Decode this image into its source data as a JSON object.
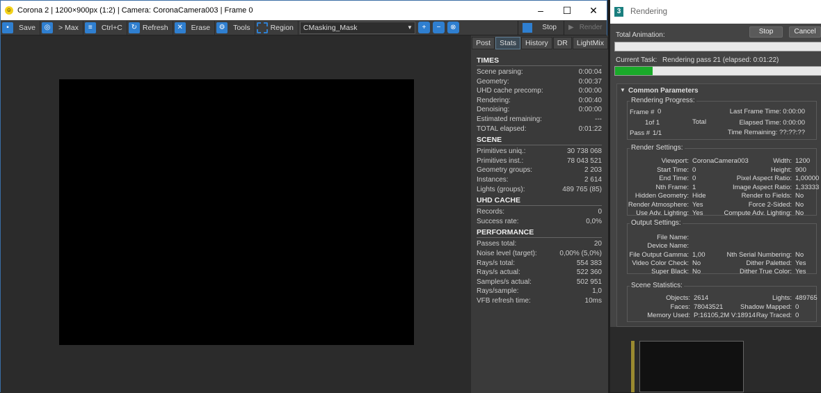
{
  "vfb": {
    "title": "Corona 2 | 1200×900px (1:2) | Camera: CoronaCamera003 | Frame 0",
    "window_controls": [
      "–",
      "☐",
      "✕"
    ],
    "toolbar": {
      "save": "Save",
      "max": "> Max",
      "copy": "Ctrl+C",
      "refresh": "Refresh",
      "erase": "Erase",
      "tools": "Tools",
      "region": "Region",
      "channel": "CMasking_Mask",
      "stop": "Stop",
      "render": "Render"
    },
    "tabs": [
      "Post",
      "Stats",
      "History",
      "DR",
      "LightMix"
    ],
    "stats": [
      {
        "header": "TIMES",
        "rows": [
          [
            "Scene parsing:",
            "0:00:04"
          ],
          [
            "Geometry:",
            "0:00:37"
          ],
          [
            "UHD cache precomp:",
            "0:00:00"
          ],
          [
            "Rendering:",
            "0:00:40"
          ],
          [
            "Denoising:",
            "0:00:00"
          ],
          [
            "Estimated remaining:",
            "---"
          ],
          [
            "TOTAL elapsed:",
            "0:01:22"
          ]
        ]
      },
      {
        "header": "SCENE",
        "rows": [
          [
            "Primitives uniq.:",
            "30 738 068"
          ],
          [
            "Primitives inst.:",
            "78 043 521"
          ],
          [
            "Geometry groups:",
            "2 203"
          ],
          [
            "Instances:",
            "2 614"
          ],
          [
            "Lights (groups):",
            "489 765 (85)"
          ]
        ]
      },
      {
        "header": "UHD CACHE",
        "rows": [
          [
            "Records:",
            "0"
          ],
          [
            "Success rate:",
            "0,0%"
          ]
        ]
      },
      {
        "header": "PERFORMANCE",
        "rows": [
          [
            "Passes total:",
            "20"
          ],
          [
            "Noise level (target):",
            "0,00% (5,0%)"
          ],
          [
            "Rays/s total:",
            "554 383"
          ],
          [
            "Rays/s actual:",
            "522 360"
          ],
          [
            "Samples/s actual:",
            "502 951"
          ],
          [
            "Rays/sample:",
            "1,0"
          ],
          [
            "VFB refresh time:",
            "10ms"
          ]
        ]
      }
    ]
  },
  "dialog": {
    "title": "Rendering",
    "stop": "Stop",
    "cancel": "Cancel",
    "total_animation": "Total Animation:",
    "total_progress": 0,
    "current_task_label": "Current Task:",
    "current_task": "Rendering pass 21 (elapsed: 0:01:22)",
    "task_progress": 0.18,
    "common_parameters": "Common Parameters",
    "progress": {
      "title": "Rendering Progress:",
      "frame_label": "Frame #",
      "frame": "0",
      "of": "1of 1",
      "total": "Total",
      "pass_label": "Pass #",
      "pass": "1/1",
      "last_frame_time": "Last Frame Time:  0:00:00",
      "elapsed_time": "Elapsed Time:  0:00:00",
      "time_remaining": "Time Remaining: ??:??:??"
    },
    "render_settings": {
      "title": "Render Settings:",
      "left": [
        [
          "Viewport:",
          "CoronaCamera003"
        ],
        [
          "Start Time:",
          "0"
        ],
        [
          "End Time:",
          "0"
        ],
        [
          "Nth Frame:",
          "1"
        ],
        [
          "Hidden Geometry:",
          "Hide"
        ],
        [
          "Render Atmosphere:",
          "Yes"
        ],
        [
          "Use Adv. Lighting:",
          "Yes"
        ]
      ],
      "right": [
        [
          "Width:",
          "1200"
        ],
        [
          "Height:",
          "900"
        ],
        [
          "Pixel Aspect Ratio:",
          "1,00000"
        ],
        [
          "Image Aspect Ratio:",
          "1,33333"
        ],
        [
          "Render to Fields:",
          "No"
        ],
        [
          "Force 2-Sided:",
          "No"
        ],
        [
          "Compute Adv. Lighting:",
          "No"
        ]
      ]
    },
    "output_settings": {
      "title": "Output Settings:",
      "left": [
        [
          "File Name:",
          ""
        ],
        [
          "Device Name:",
          ""
        ],
        [
          "File Output Gamma:",
          "1,00"
        ],
        [
          "Video Color Check:",
          "No"
        ],
        [
          "Super Black:",
          "No"
        ]
      ],
      "right": [
        [
          "",
          ""
        ],
        [
          "",
          ""
        ],
        [
          "Nth Serial Numbering:",
          "No"
        ],
        [
          "Dither Paletted:",
          "Yes"
        ],
        [
          "Dither True Color:",
          "Yes"
        ]
      ]
    },
    "scene_statistics": {
      "title": "Scene Statistics:",
      "left": [
        [
          "Objects:",
          "2614"
        ],
        [
          "Faces:",
          "78043521"
        ],
        [
          "Memory Used:",
          "P:16105,2M V:18914"
        ]
      ],
      "right": [
        [
          "Lights:",
          "489765"
        ],
        [
          "Shadow Mapped:",
          "0"
        ],
        [
          "Ray Traced:",
          "0"
        ]
      ]
    }
  }
}
